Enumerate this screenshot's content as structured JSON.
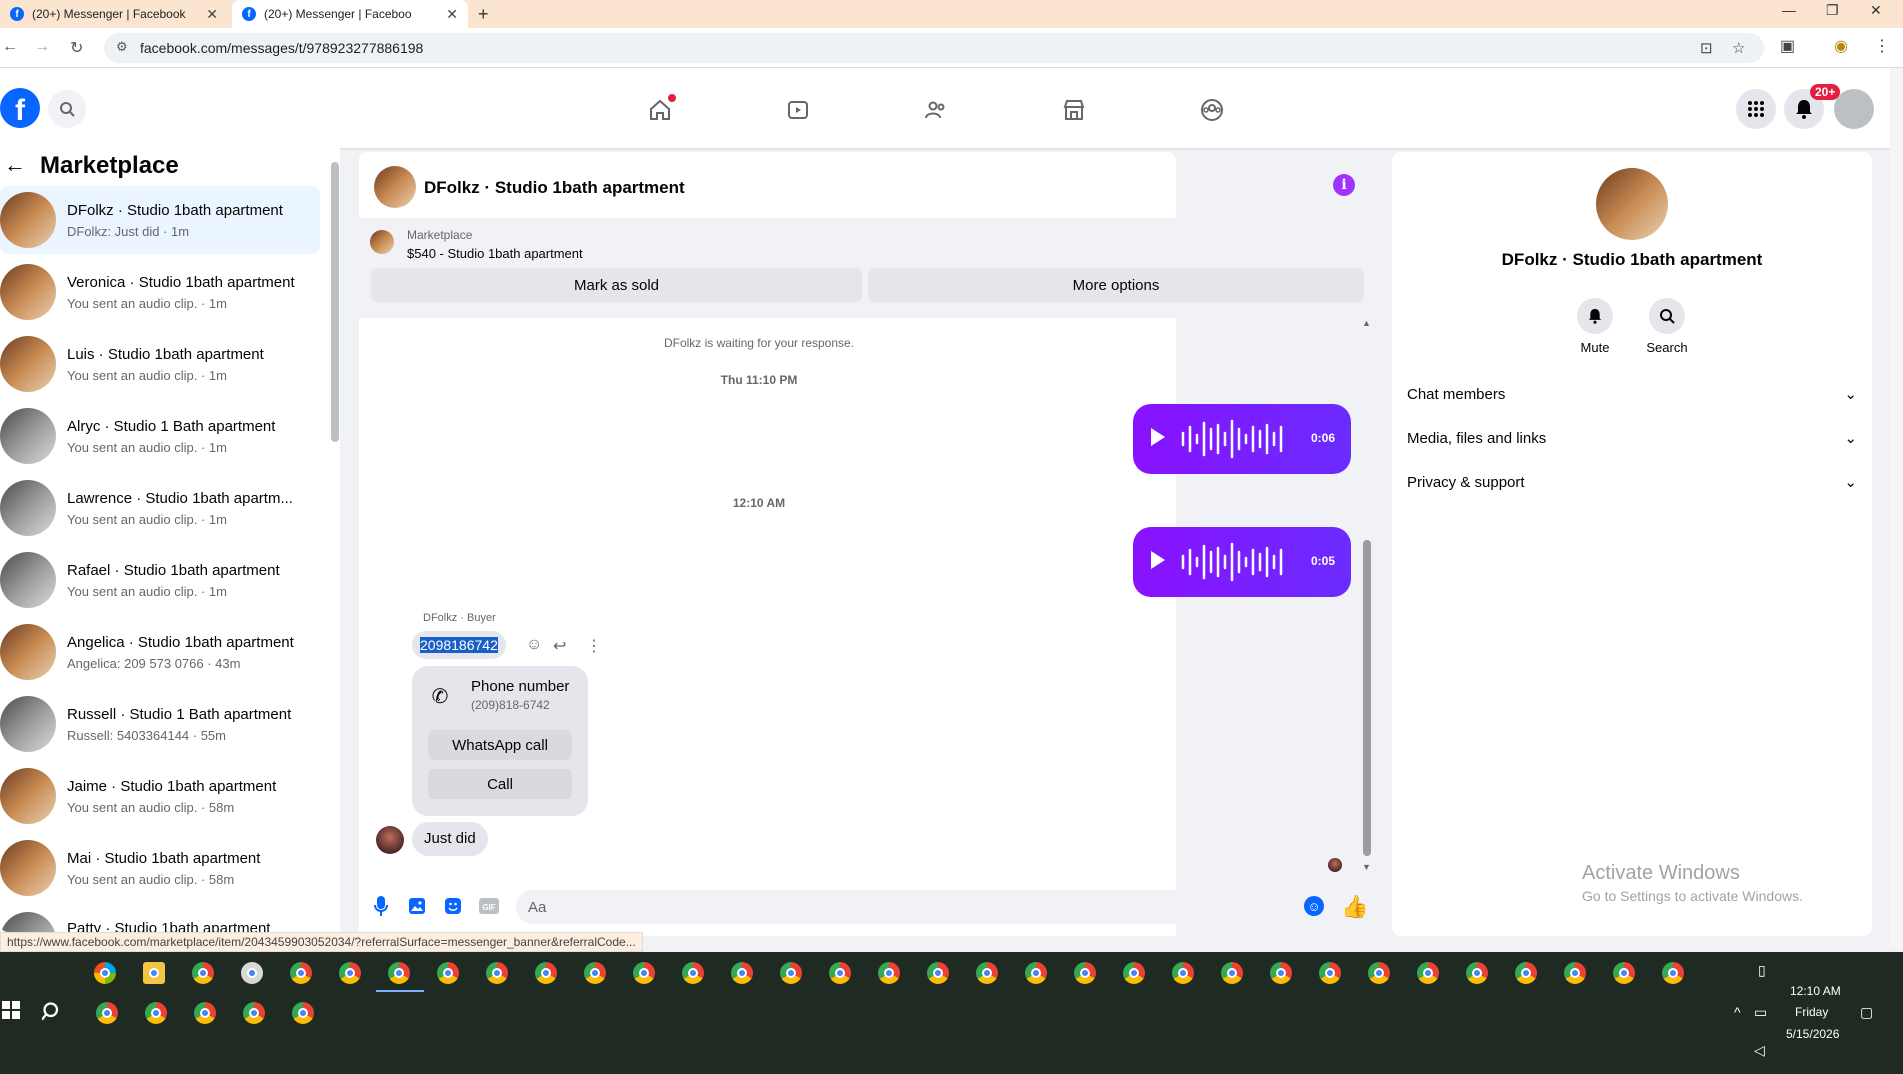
{
  "browser": {
    "tabs": [
      {
        "title": "(20+) Messenger | Facebook"
      },
      {
        "title": "(20+) Messenger | Faceboo"
      }
    ],
    "url": "facebook.com/messages/t/978923277886198",
    "status_url": "https://www.facebook.com/marketplace/item/2043459903052034/?referralSurface=messenger_banner&referralCode..."
  },
  "fbnav": {
    "logo": "f",
    "notifications_badge": "20+"
  },
  "sidebar": {
    "title": "Marketplace",
    "conversations": [
      {
        "name": "DFolkz · Studio 1bath apartment",
        "preview": "DFolkz: Just did · 1m"
      },
      {
        "name": "Veronica · Studio 1bath apartment",
        "preview": "You sent an audio clip. · 1m"
      },
      {
        "name": "Luis · Studio 1bath apartment",
        "preview": "You sent an audio clip. · 1m"
      },
      {
        "name": "Alryc · Studio 1 Bath apartment",
        "preview": "You sent an audio clip. · 1m"
      },
      {
        "name": "Lawrence · Studio 1bath apartm...",
        "preview": "You sent an audio clip. · 1m"
      },
      {
        "name": "Rafael · Studio 1bath apartment",
        "preview": "You sent an audio clip. · 1m"
      },
      {
        "name": "Angelica · Studio 1bath apartment",
        "preview": "Angelica: 209 573 0766 · 43m"
      },
      {
        "name": "Russell · Studio 1 Bath apartment",
        "preview": "Russell: 5403364144 · 55m"
      },
      {
        "name": "Jaime · Studio 1bath apartment",
        "preview": "You sent an audio clip. · 58m"
      },
      {
        "name": "Mai · Studio 1bath apartment",
        "preview": "You sent an audio clip. · 58m"
      },
      {
        "name": "Patty · Studio 1bath apartment",
        "preview": ""
      }
    ]
  },
  "chat": {
    "title": "DFolkz · Studio 1bath apartment",
    "banner": {
      "label": "Marketplace",
      "listing": "$540 - Studio 1bath apartment",
      "mark_sold": "Mark as sold",
      "more_options": "More options"
    },
    "waiting_text": "DFolkz is waiting for your response.",
    "timestamp1": "Thu 11:10 PM",
    "audio1_duration": "0:06",
    "timestamp2": "12:10 AM",
    "audio2_duration": "0:05",
    "sender_label": "DFolkz · Buyer",
    "phone_message": "2098186742",
    "phone_card": {
      "title": "Phone number",
      "number": "(209)818-6742",
      "whatsapp": "WhatsApp call",
      "call": "Call"
    },
    "last_message": "Just did",
    "composer_placeholder": "Aa"
  },
  "rpanel": {
    "name": "DFolkz · Studio 1bath apartment",
    "mute": "Mute",
    "search": "Search",
    "sections": [
      "Chat members",
      "Media, files and links",
      "Privacy & support"
    ]
  },
  "watermark": {
    "line1": "Activate Windows",
    "line2": "Go to Settings to activate Windows."
  },
  "taskbar": {
    "time": "12:10 AM",
    "day": "Friday",
    "date": "5/15/2026"
  }
}
